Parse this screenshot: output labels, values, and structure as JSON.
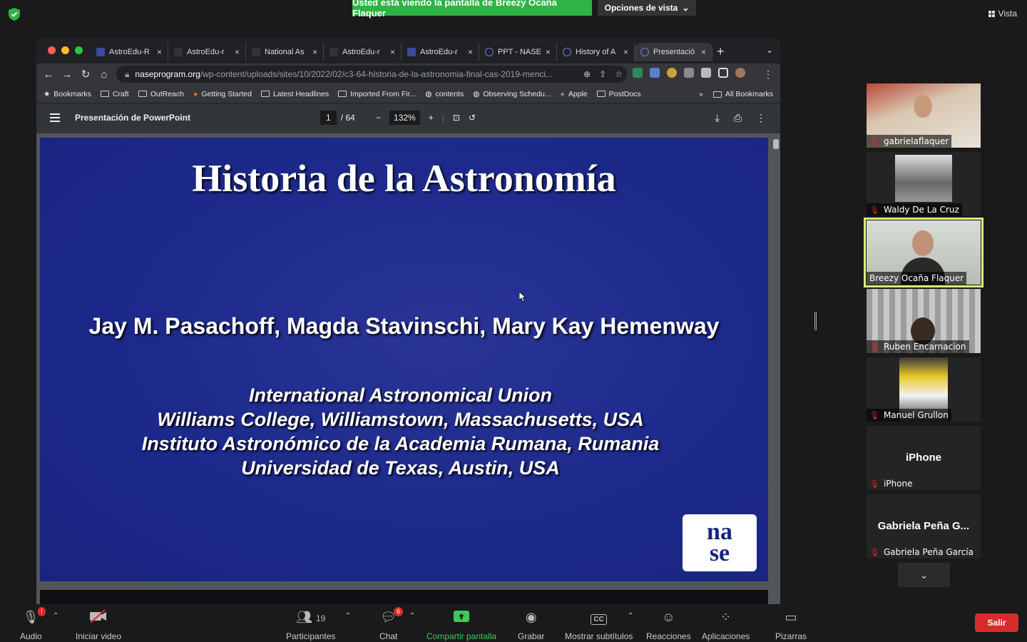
{
  "zoom": {
    "share_banner": "Usted está viendo la pantalla de Breezy Ocaña Flaquer",
    "view_options": "Opciones de vista",
    "vista": "Vista",
    "leave": "Salir"
  },
  "browser": {
    "tabs": [
      {
        "title": "AstroEdu-R"
      },
      {
        "title": "AstroEdu-r"
      },
      {
        "title": "National As"
      },
      {
        "title": "AstroEdu-r"
      },
      {
        "title": "AstroEdu-r"
      },
      {
        "title": "PPT - NASE"
      },
      {
        "title": "History of A"
      },
      {
        "title": "Presentació"
      }
    ],
    "url_host": "naseprogram.org",
    "url_path": "/wp-content/uploads/sites/10/2022/02/c3-64-historia-de-la-astronomia-final-cas-2019-menci...",
    "bookmarks": [
      "Bookmarks",
      "Craft",
      "OutReach",
      "Getting Started",
      "Latest Headlines",
      "Imported From Fir...",
      "contents",
      "Observing Schedu...",
      "Apple",
      "PostDocs"
    ],
    "all_bookmarks": "All Bookmarks"
  },
  "pdf": {
    "title": "Presentación de PowerPoint",
    "page_current": "1",
    "page_total": "/ 64",
    "zoom": "132%"
  },
  "slide": {
    "title": "Historia de la Astronomía",
    "authors": "Jay M. Pasachoff, Magda Stavinschi, Mary Kay Hemenway",
    "affiliations": [
      "International Astronomical Union",
      "Williams College, Williamstown, Massachusetts, USA",
      "Instituto Astronómico de la Academia Rumana, Rumania",
      "Universidad de Texas, Austin, USA"
    ],
    "logo_top": "na",
    "logo_bottom": "se"
  },
  "participants": [
    {
      "name": "gabrielaflaquer"
    },
    {
      "name": "Waldy De La Cruz"
    },
    {
      "name": "Breezy Ocaña Flaquer"
    },
    {
      "name": "Ruben Encarnacion"
    },
    {
      "name": "Manuel Grullon"
    },
    {
      "name": "iPhone",
      "placeholder": "iPhone"
    },
    {
      "name": "Gabriela Peña García",
      "placeholder": "Gabriela Peña G..."
    }
  ],
  "controls": {
    "audio": "Audio",
    "audio_badge": "!",
    "video": "Iniciar video",
    "participants": "Participantes",
    "participants_count": "19",
    "chat": "Chat",
    "chat_badge": "6",
    "share": "Compartir pantalla",
    "record": "Grabar",
    "captions": "Mostrar subtítulos",
    "captions_icon": "CC",
    "reactions": "Reacciones",
    "apps": "Aplicaciones",
    "whiteboards": "Pizarras"
  },
  "colors": {
    "share_green": "#2fb344",
    "slide_blue": "#1d2a8c",
    "speaker_outline": "#dcf27a",
    "leave_red": "#d62c2c"
  }
}
